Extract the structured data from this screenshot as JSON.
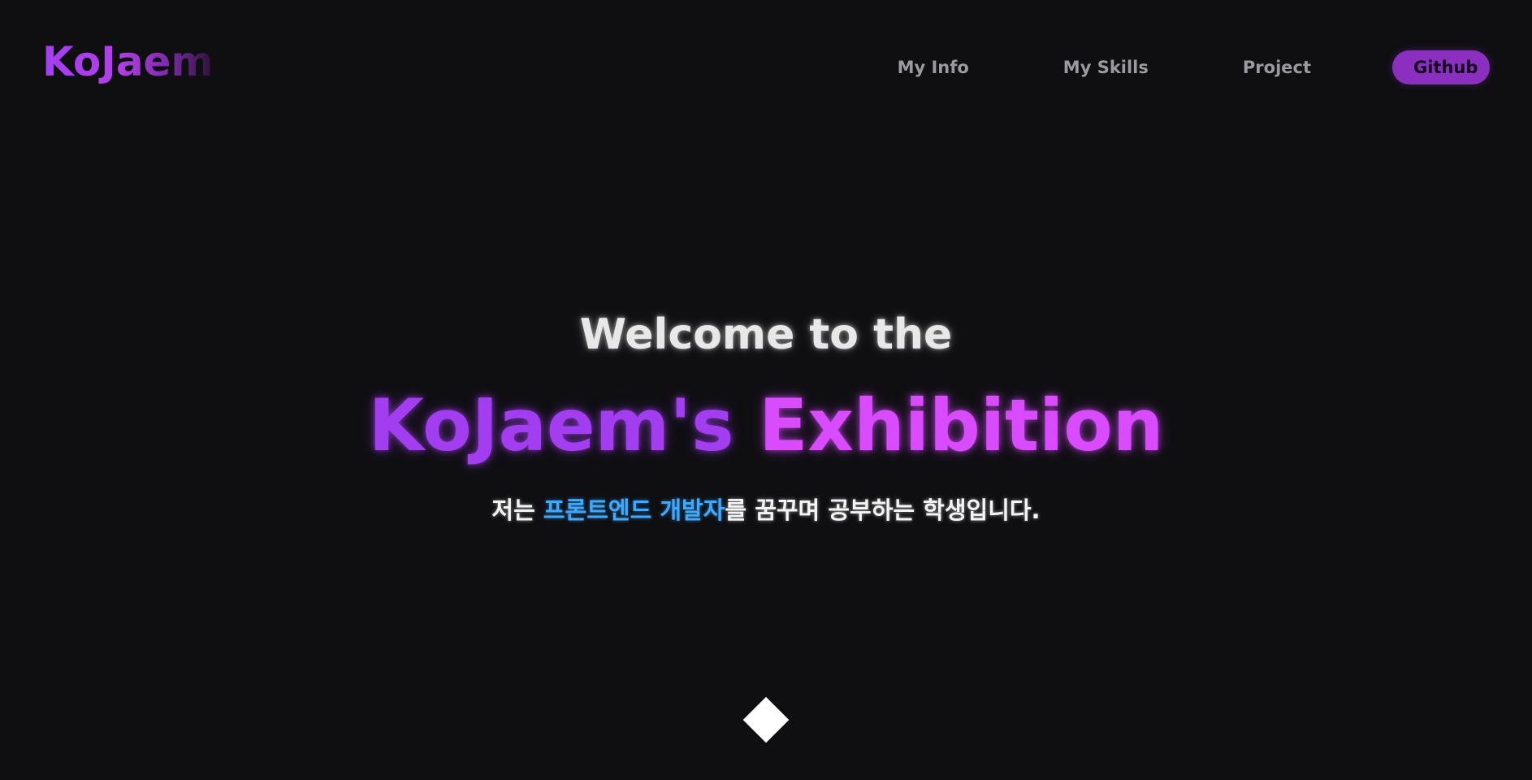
{
  "header": {
    "logo": "KoJaem",
    "nav": [
      {
        "label": "My Info"
      },
      {
        "label": "My Skills"
      },
      {
        "label": "Project"
      }
    ],
    "github_label": "Github"
  },
  "hero": {
    "welcome": "Welcome to the",
    "title_part1": "KoJaem's",
    "title_part2": "Exhibition",
    "subtitle_before": "저는 ",
    "subtitle_highlight": "프론트엔드 개발자",
    "subtitle_after": "를 꿈꾸며 공부하는 학생입니다."
  },
  "icons": {
    "scroll": "diamond-icon"
  },
  "colors": {
    "background": "#0f0f12",
    "accent_purple": "#a33ef0",
    "accent_magenta": "#d84bff",
    "highlight_blue": "#3fa9ff",
    "github_button": "#8a2fc0"
  }
}
